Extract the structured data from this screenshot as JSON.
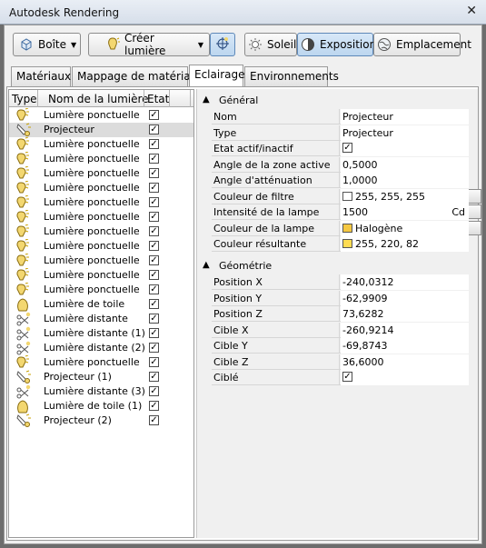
{
  "window": {
    "title": "Autodesk Rendering",
    "close_icon": "close-icon"
  },
  "toolbar": {
    "box_label": "Boîte",
    "create_light_label": "Créer lumière",
    "sun_label": "Soleil",
    "exposure_label": "Exposition",
    "location_label": "Emplacement"
  },
  "tabs": [
    "Matériaux",
    "Mappage de matériaux",
    "Eclairage",
    "Environnements"
  ],
  "selected_tab": "Eclairage",
  "list": {
    "headers": {
      "type": "Type",
      "name": "Nom de la lumière",
      "state": "Etat"
    },
    "items": [
      {
        "name": "Lumière ponctuelle",
        "icon": "point-light-icon",
        "on": true
      },
      {
        "name": "Projecteur",
        "icon": "spot-light-icon",
        "on": true,
        "selected": true
      },
      {
        "name": "Lumière ponctuelle",
        "icon": "point-light-icon",
        "on": true
      },
      {
        "name": "Lumière ponctuelle",
        "icon": "point-light-icon",
        "on": true
      },
      {
        "name": "Lumière ponctuelle",
        "icon": "point-light-icon",
        "on": true
      },
      {
        "name": "Lumière ponctuelle",
        "icon": "point-light-icon",
        "on": true
      },
      {
        "name": "Lumière ponctuelle",
        "icon": "point-light-icon",
        "on": true
      },
      {
        "name": "Lumière ponctuelle",
        "icon": "point-light-icon",
        "on": true
      },
      {
        "name": "Lumière ponctuelle",
        "icon": "point-light-icon",
        "on": true
      },
      {
        "name": "Lumière ponctuelle",
        "icon": "point-light-icon",
        "on": true
      },
      {
        "name": "Lumière ponctuelle",
        "icon": "point-light-icon",
        "on": true
      },
      {
        "name": "Lumière ponctuelle",
        "icon": "point-light-icon",
        "on": true
      },
      {
        "name": "Lumière ponctuelle",
        "icon": "point-light-icon",
        "on": true
      },
      {
        "name": "Lumière de toile",
        "icon": "web-light-icon",
        "on": true
      },
      {
        "name": "Lumière distante",
        "icon": "distant-light-icon",
        "on": true
      },
      {
        "name": "Lumière distante (1)",
        "icon": "distant-light-icon",
        "on": true
      },
      {
        "name": "Lumière distante (2)",
        "icon": "distant-light-icon",
        "on": true
      },
      {
        "name": "Lumière ponctuelle",
        "icon": "point-light-icon",
        "on": true
      },
      {
        "name": "Projecteur (1)",
        "icon": "spot-light-icon",
        "on": true
      },
      {
        "name": "Lumière distante (3)",
        "icon": "distant-light-icon",
        "on": true
      },
      {
        "name": "Lumière de toile (1)",
        "icon": "web-light-icon",
        "on": true
      },
      {
        "name": "Projecteur (2)",
        "icon": "spot-light-icon",
        "on": true
      }
    ]
  },
  "props": {
    "general": {
      "title": "Général",
      "rows": [
        {
          "k": "Nom",
          "v": "Projecteur"
        },
        {
          "k": "Type",
          "v": "Projecteur"
        },
        {
          "k": "Etat actif/inactif",
          "v": "",
          "check": true
        },
        {
          "k": "Angle de la zone active",
          "v": "0,5000"
        },
        {
          "k": "Angle d'atténuation",
          "v": "1,0000"
        },
        {
          "k": "Couleur de filtre",
          "v": "255, 255, 255",
          "swatch": "#ffffff",
          "btn": true
        },
        {
          "k": "Intensité de la lampe",
          "v": "1500",
          "unit": "Cd",
          "btn": true
        },
        {
          "k": "Couleur de la lampe",
          "v": "Halogène",
          "swatch": "#f5c842",
          "btn": true
        },
        {
          "k": "Couleur résultante",
          "v": "255, 220, 82",
          "swatch": "#ffdc52"
        }
      ]
    },
    "geometry": {
      "title": "Géométrie",
      "rows": [
        {
          "k": "Position X",
          "v": "-240,0312"
        },
        {
          "k": "Position Y",
          "v": "-62,9909"
        },
        {
          "k": "Position Z",
          "v": "73,6282"
        },
        {
          "k": "Cible X",
          "v": "-260,9214"
        },
        {
          "k": "Cible Y",
          "v": "-69,8743"
        },
        {
          "k": "Cible Z",
          "v": "36,6000"
        },
        {
          "k": "Ciblé",
          "v": "",
          "check": true
        }
      ]
    }
  }
}
